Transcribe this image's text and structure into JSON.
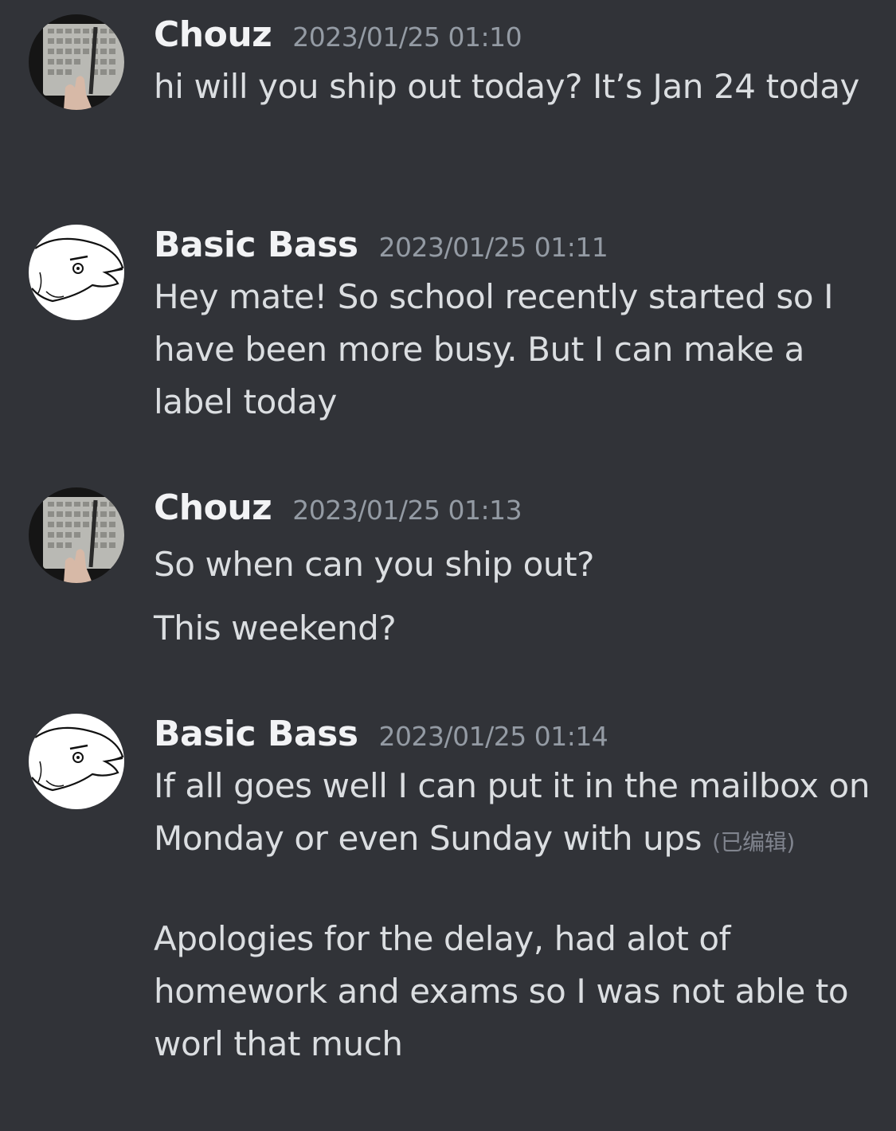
{
  "messages": [
    {
      "author": "Chouz",
      "avatar_icon": "keyboard-photo-avatar",
      "timestamp": "2023/01/25 01:10",
      "lines": [
        "hi will you ship out today? It’s Jan 24 today"
      ]
    },
    {
      "author": "Basic Bass",
      "avatar_icon": "fish-drawing-avatar",
      "timestamp": "2023/01/25 01:11",
      "lines": [
        "Hey mate! So school recently started so I have been more busy. But I can make a label today"
      ]
    },
    {
      "author": "Chouz",
      "avatar_icon": "keyboard-photo-avatar",
      "timestamp": "2023/01/25 01:13",
      "lines": [
        "So when can you ship out?",
        "This weekend?"
      ]
    },
    {
      "author": "Basic Bass",
      "avatar_icon": "fish-drawing-avatar",
      "timestamp": "2023/01/25 01:14",
      "lines": [
        "If all goes well I can put it in the mailbox on Monday or even Sunday with ups",
        "Apologies for the delay, had alot of homework and exams so I was not able to worl that much"
      ],
      "edited_label": "(已编辑)"
    }
  ],
  "colors": {
    "background": "#313338",
    "username": "#f2f3f5",
    "timestamp": "#949ba4",
    "message_text": "#dbdee1",
    "edited": "#80848e"
  }
}
